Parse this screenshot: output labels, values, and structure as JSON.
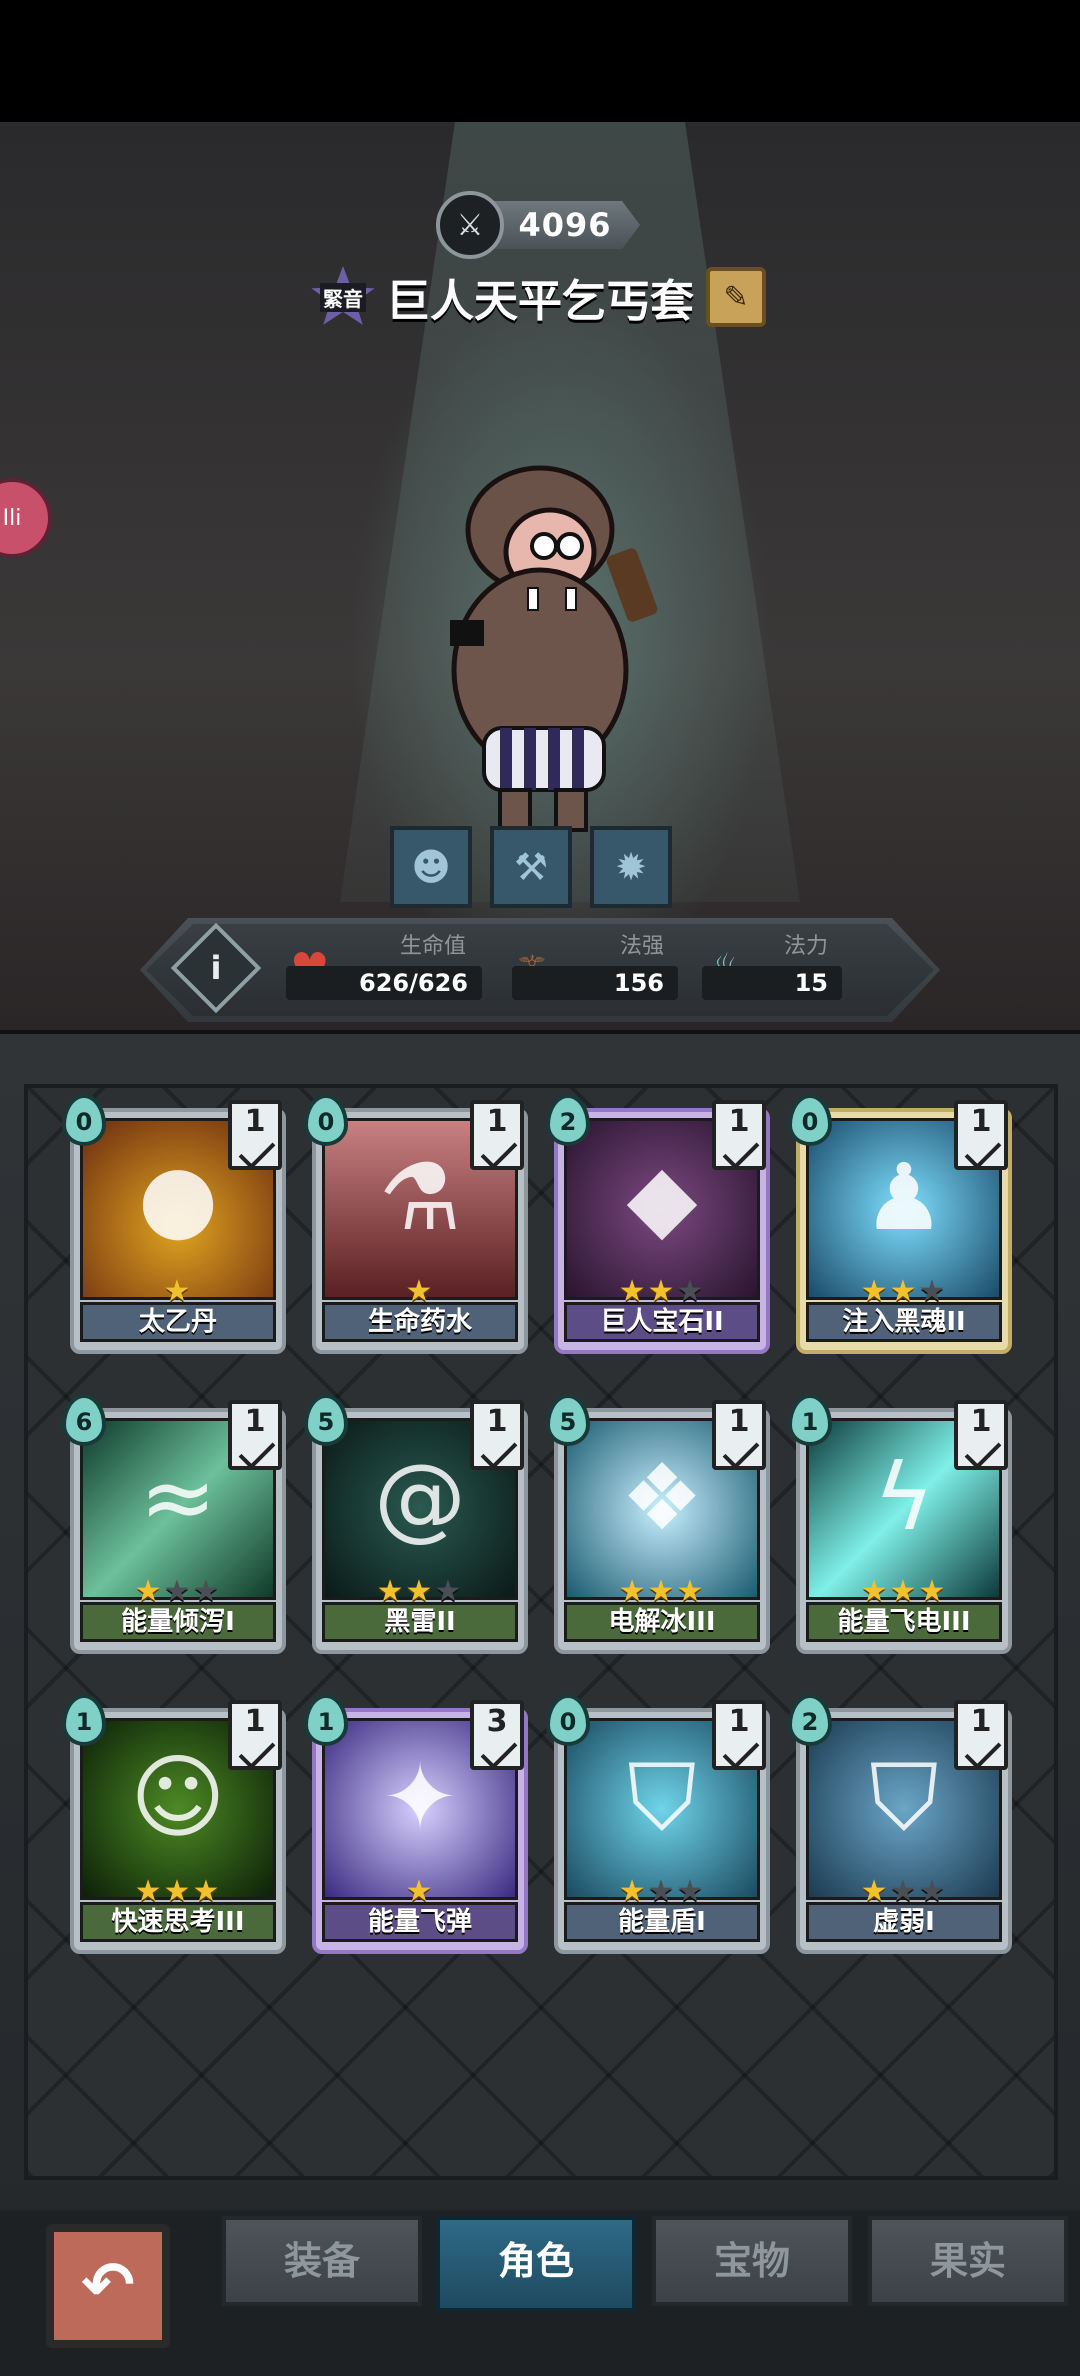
{
  "header": {
    "power": "4096",
    "rarity_label": "緊音",
    "character_name": "巨人天平乞丐套"
  },
  "side_bubble": "Ili",
  "stats": {
    "hp_label": "生命值",
    "hp_value": "626/626",
    "power_label": "法强",
    "power_value": "156",
    "mana_label": "法力",
    "mana_value": "15"
  },
  "cards": [
    {
      "name": "太乙丹",
      "cost": "0",
      "level": "1",
      "stars": 1,
      "max_stars": 1,
      "rarity": "blue",
      "icon": "pill-bowl-icon"
    },
    {
      "name": "生命药水",
      "cost": "0",
      "level": "1",
      "stars": 1,
      "max_stars": 1,
      "rarity": "blue",
      "icon": "potion-icon"
    },
    {
      "name": "巨人宝石II",
      "cost": "2",
      "level": "1",
      "stars": 2,
      "max_stars": 3,
      "rarity": "purple",
      "icon": "gem-icon"
    },
    {
      "name": "注入黑魂II",
      "cost": "0",
      "level": "1",
      "stars": 2,
      "max_stars": 3,
      "rarity": "gold",
      "icon": "soul-icon"
    },
    {
      "name": "能量倾泻I",
      "cost": "6",
      "level": "1",
      "stars": 1,
      "max_stars": 3,
      "rarity": "green",
      "icon": "energy-wave-icon"
    },
    {
      "name": "黑雷II",
      "cost": "5",
      "level": "1",
      "stars": 2,
      "max_stars": 3,
      "rarity": "green",
      "icon": "dark-thunder-icon"
    },
    {
      "name": "电解冰III",
      "cost": "5",
      "level": "1",
      "stars": 3,
      "max_stars": 3,
      "rarity": "green",
      "icon": "ice-cube-icon"
    },
    {
      "name": "能量飞电III",
      "cost": "1",
      "level": "1",
      "stars": 3,
      "max_stars": 3,
      "rarity": "green",
      "icon": "lightning-icon"
    },
    {
      "name": "快速思考III",
      "cost": "1",
      "level": "1",
      "stars": 3,
      "max_stars": 3,
      "rarity": "green",
      "icon": "thinking-icon"
    },
    {
      "name": "能量飞弹",
      "cost": "1",
      "level": "3",
      "stars": 1,
      "max_stars": 1,
      "rarity": "purple",
      "icon": "missile-icon"
    },
    {
      "name": "能量盾I",
      "cost": "0",
      "level": "1",
      "stars": 1,
      "max_stars": 3,
      "rarity": "blue",
      "icon": "shield-icon"
    },
    {
      "name": "虚弱I",
      "cost": "2",
      "level": "1",
      "stars": 1,
      "max_stars": 3,
      "rarity": "blue",
      "icon": "weak-shield-icon"
    }
  ],
  "nav": {
    "tabs": [
      "装备",
      "角色",
      "宝物",
      "果实"
    ],
    "active": "角色"
  },
  "colors": {
    "accent_teal": "#2e6a86",
    "star_gold": "#f2c12e"
  }
}
